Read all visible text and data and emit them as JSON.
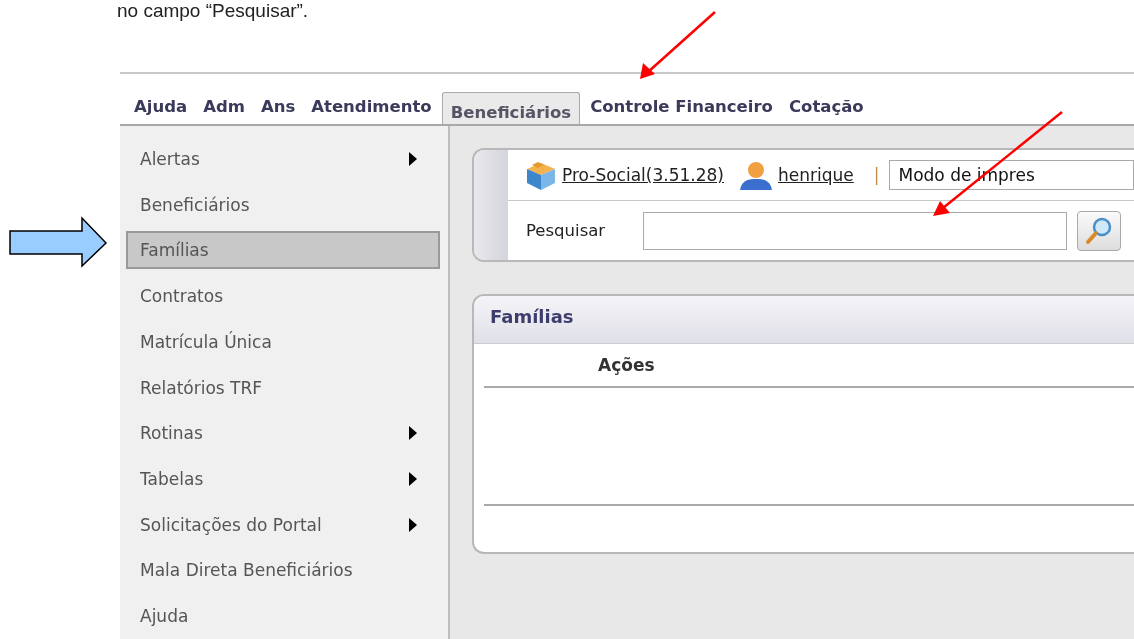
{
  "caption": "no campo “Pesquisar”.",
  "tabs": [
    {
      "label": "Ajuda",
      "selected": false
    },
    {
      "label": "Adm",
      "selected": false
    },
    {
      "label": "Ans",
      "selected": false
    },
    {
      "label": "Atendimento",
      "selected": false
    },
    {
      "label": "Beneficiários",
      "selected": true
    },
    {
      "label": "Controle Financeiro",
      "selected": false
    },
    {
      "label": "Cotação",
      "selected": false
    }
  ],
  "sidebar": {
    "items": [
      {
        "label": "Alertas",
        "selected": false,
        "submenu": true
      },
      {
        "label": "Beneficiários",
        "selected": false,
        "submenu": false
      },
      {
        "label": "Famílias",
        "selected": true,
        "submenu": false
      },
      {
        "label": "Contratos",
        "selected": false,
        "submenu": false
      },
      {
        "label": "Matrícula Única",
        "selected": false,
        "submenu": false
      },
      {
        "label": "Relatórios TRF",
        "selected": false,
        "submenu": false
      },
      {
        "label": "Rotinas",
        "selected": false,
        "submenu": true
      },
      {
        "label": "Tabelas",
        "selected": false,
        "submenu": true
      },
      {
        "label": "Solicitações do Portal",
        "selected": false,
        "submenu": true
      },
      {
        "label": "Mala Direta Beneficiários",
        "selected": false,
        "submenu": false
      },
      {
        "label": "Ajuda",
        "selected": false,
        "submenu": false
      }
    ]
  },
  "toolbar": {
    "app_link": "Pro-Social(3.51.28)",
    "user_link": "henrique",
    "separator": "|",
    "mode_select": "Modo de impres"
  },
  "search": {
    "label": "Pesquisar"
  },
  "panel": {
    "title": "Famílias",
    "columns": [
      "Ações"
    ]
  }
}
